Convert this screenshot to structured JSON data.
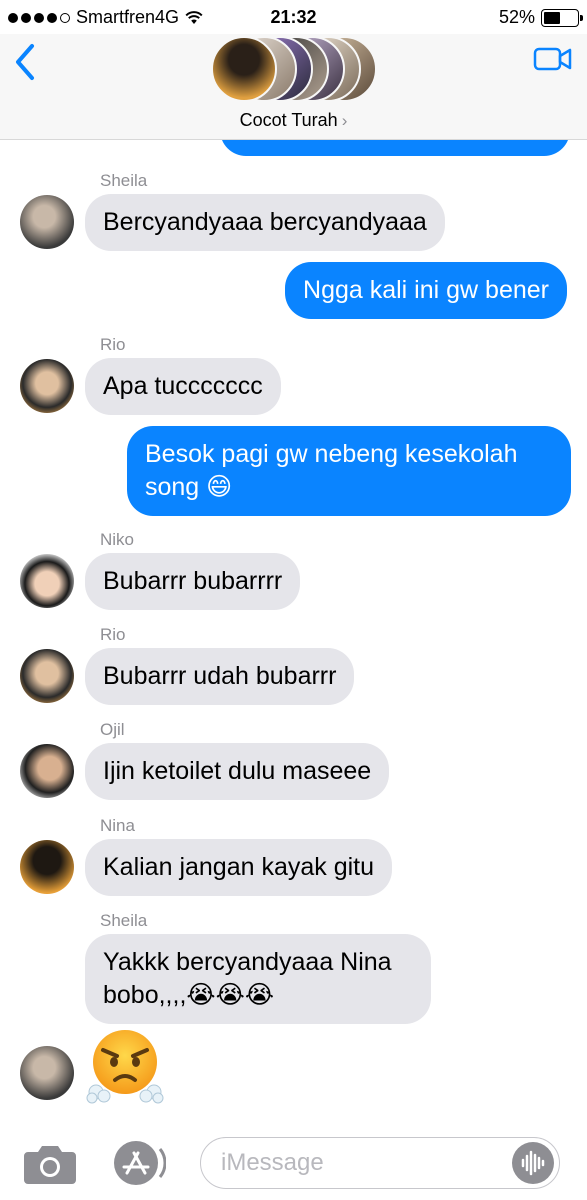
{
  "status_bar": {
    "carrier": "Smartfren4G",
    "time": "21:32",
    "battery": "52%",
    "battery_level": 0.52,
    "signal_bars": 4
  },
  "header": {
    "group_name": "Cocot Turah",
    "chevron": "›"
  },
  "messages": [
    {
      "type": "in",
      "sender": "Sheila",
      "text": "Bercyandyaaa bercyandyaaa"
    },
    {
      "type": "out",
      "text": "Ngga kali ini gw bener"
    },
    {
      "type": "in",
      "sender": "Rio",
      "text": "Apa tuccccccc"
    },
    {
      "type": "out",
      "text": "Besok pagi gw nebeng kesekolah song 😄"
    },
    {
      "type": "in",
      "sender": "Niko",
      "text": "Bubarrr bubarrrr"
    },
    {
      "type": "in",
      "sender": "Rio",
      "text": "Bubarrr udah bubarrr"
    },
    {
      "type": "in",
      "sender": "Ojil",
      "text": "Ijin ketoilet dulu maseee"
    },
    {
      "type": "in",
      "sender": "Nina",
      "text": "Kalian jangan kayak gitu"
    },
    {
      "type": "in",
      "sender": "Sheila",
      "text": "Yakkk bercyandyaaa Nina bobo,,,,😭😭😭"
    },
    {
      "type": "in",
      "sender": "",
      "emoji": "face-with-steam-from-nose"
    }
  ],
  "input": {
    "placeholder": "iMessage"
  },
  "colors": {
    "accent": "#0a84ff",
    "incoming_bubble": "#e5e5ea",
    "secondary_text": "#8e8e93"
  }
}
